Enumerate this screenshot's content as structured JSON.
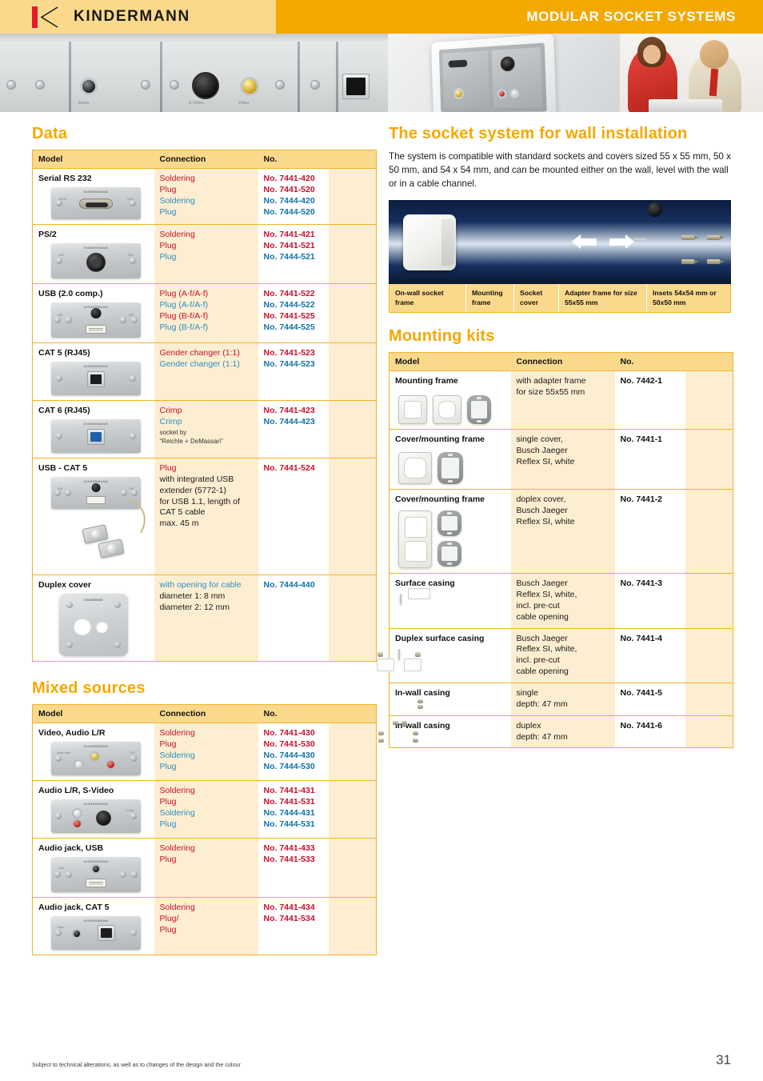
{
  "header": {
    "brand": "KINDERMANN",
    "title": "MODULAR SOCKET SYSTEMS",
    "logo_icon": "kindermann-chevron-logo"
  },
  "data_section": {
    "heading": "Data",
    "columns": [
      "Model",
      "Connection",
      "No."
    ],
    "rows": [
      {
        "model": "Serial RS 232",
        "image": "serial-rs232-faceplate",
        "connections": [
          {
            "text": "Soldering",
            "color": "red"
          },
          {
            "text": "Plug",
            "color": "red"
          },
          {
            "text": "Soldering",
            "color": "blue"
          },
          {
            "text": "Plug",
            "color": "blue"
          }
        ],
        "numbers": [
          {
            "text": "No. 7441-420",
            "color": "red"
          },
          {
            "text": "No. 7441-520",
            "color": "red"
          },
          {
            "text": "No. 7444-420",
            "color": "blue"
          },
          {
            "text": "No. 7444-520",
            "color": "blue"
          }
        ]
      },
      {
        "model": "PS/2",
        "image": "ps2-faceplate",
        "connections": [
          {
            "text": "Soldering",
            "color": "red"
          },
          {
            "text": "Plug",
            "color": "red"
          },
          {
            "text": "Plug",
            "color": "blue"
          }
        ],
        "numbers": [
          {
            "text": "No. 7441-421",
            "color": "red"
          },
          {
            "text": "No. 7441-521",
            "color": "red"
          },
          {
            "text": "No. 7444-521",
            "color": "blue"
          }
        ]
      },
      {
        "model": "USB (2.0 comp.)",
        "image": "usb-faceplate",
        "connections": [
          {
            "text": "Plug (A-f/A-f)",
            "color": "red"
          },
          {
            "text": "Plug (A-f/A-f)",
            "color": "blue"
          },
          {
            "text": "Plug (B-f/A-f)",
            "color": "red"
          },
          {
            "text": "Plug (B-f/A-f)",
            "color": "blue"
          }
        ],
        "numbers": [
          {
            "text": "No. 7441-522",
            "color": "red"
          },
          {
            "text": "No. 7444-522",
            "color": "blue"
          },
          {
            "text": "No. 7441-525",
            "color": "red"
          },
          {
            "text": "No. 7444-525",
            "color": "blue"
          }
        ]
      },
      {
        "model": "CAT 5 (RJ45)",
        "image": "cat5-rj45-faceplate",
        "connections": [
          {
            "text": "Gender changer (1:1)",
            "color": "red"
          },
          {
            "text": "Gender changer (1:1)",
            "color": "blue"
          }
        ],
        "numbers": [
          {
            "text": "No. 7441-523",
            "color": "red"
          },
          {
            "text": "No. 7444-523",
            "color": "blue"
          }
        ]
      },
      {
        "model": "CAT 6 (RJ45)",
        "image": "cat6-rj45-faceplate",
        "connections": [
          {
            "text": "Crimp",
            "color": "red"
          },
          {
            "text": "Crimp",
            "color": "blue"
          }
        ],
        "note_lines": [
          "socket by",
          "“Reichle + DeMassari”"
        ],
        "numbers": [
          {
            "text": "No. 7441-423",
            "color": "red"
          },
          {
            "text": "No. 7444-423",
            "color": "blue"
          }
        ]
      },
      {
        "model": "USB - CAT 5",
        "image": "usb-cat5-extender-faceplate",
        "connections": [
          {
            "text": "Plug",
            "color": "red"
          },
          {
            "text": "with integrated USB",
            "color": "dark"
          },
          {
            "text": "extender (5772-1)",
            "color": "dark"
          },
          {
            "text": "for USB 1.1, length of",
            "color": "dark"
          },
          {
            "text": "CAT 5 cable",
            "color": "dark"
          },
          {
            "text": "max. 45 m",
            "color": "dark"
          }
        ],
        "numbers": [
          {
            "text": "No. 7441-524",
            "color": "red"
          }
        ]
      },
      {
        "model": "Duplex cover",
        "image": "duplex-cover-plate",
        "connections": [
          {
            "text": "with opening for cable",
            "color": "blue"
          },
          {
            "text": "diameter 1:  8 mm",
            "color": "dark"
          },
          {
            "text": "diameter 2: 12 mm",
            "color": "dark"
          }
        ],
        "numbers": [
          {
            "text": "No. 7444-440",
            "color": "blue"
          }
        ]
      }
    ]
  },
  "mixed_section": {
    "heading": "Mixed sources",
    "columns": [
      "Model",
      "Connection",
      "No."
    ],
    "rows": [
      {
        "model": "Video, Audio L/R",
        "image": "video-audio-lr-faceplate",
        "connections": [
          {
            "text": "Soldering",
            "color": "red"
          },
          {
            "text": "Plug",
            "color": "red"
          },
          {
            "text": "Soldering",
            "color": "blue"
          },
          {
            "text": "Plug",
            "color": "blue"
          }
        ],
        "numbers": [
          {
            "text": "No. 7441-430",
            "color": "red"
          },
          {
            "text": "No. 7441-530",
            "color": "red"
          },
          {
            "text": "No. 7444-430",
            "color": "blue"
          },
          {
            "text": "No. 7444-530",
            "color": "blue"
          }
        ]
      },
      {
        "model": "Audio L/R, S-Video",
        "image": "audio-lr-svideo-faceplate",
        "connections": [
          {
            "text": "Soldering",
            "color": "red"
          },
          {
            "text": "Plug",
            "color": "red"
          },
          {
            "text": "Soldering",
            "color": "blue"
          },
          {
            "text": "Plug",
            "color": "blue"
          }
        ],
        "numbers": [
          {
            "text": "No. 7441-431",
            "color": "red"
          },
          {
            "text": "No. 7441-531",
            "color": "red"
          },
          {
            "text": "No. 7444-431",
            "color": "blue"
          },
          {
            "text": "No. 7444-531",
            "color": "blue"
          }
        ]
      },
      {
        "model": "Audio jack, USB",
        "image": "audio-jack-usb-faceplate",
        "connections": [
          {
            "text": "Soldering",
            "color": "red"
          },
          {
            "text": "Plug",
            "color": "red"
          }
        ],
        "numbers": [
          {
            "text": "No. 7441-433",
            "color": "red"
          },
          {
            "text": "No. 7441-533",
            "color": "red"
          }
        ]
      },
      {
        "model": "Audio jack, CAT 5",
        "image": "audio-jack-cat5-faceplate",
        "connections": [
          {
            "text": "Soldering",
            "color": "red"
          },
          {
            "text": "Plug/",
            "color": "red"
          },
          {
            "text": "Plug",
            "color": "red"
          }
        ],
        "numbers": [
          {
            "text": "No. 7441-434",
            "color": "red"
          },
          {
            "text": "No. 7441-534",
            "color": "red"
          }
        ]
      }
    ]
  },
  "wall_section": {
    "heading": "The socket system for wall installation",
    "intro": "The system is compatible with standard sockets and covers sized 55 x 55 mm, 50 x 50 mm, and 54 x 54 mm, and can be mounted either on the wall, level with the wall or in a cable channel.",
    "diagram_image": "exploded-socket-assembly",
    "captions": [
      "On-wall socket frame",
      "Mounting frame",
      "Socket cover",
      "Adapter frame for size 55x55 mm",
      "Insets 54x54 mm or 50x50 mm"
    ]
  },
  "mounting_section": {
    "heading": "Mounting kits",
    "columns": [
      "Model",
      "Connection",
      "No."
    ],
    "rows": [
      {
        "model": "Mounting frame",
        "image": "mounting-frame-set",
        "connections": [
          {
            "text": "with adapter frame",
            "color": "dark"
          },
          {
            "text": "for size 55x55 mm",
            "color": "dark"
          }
        ],
        "numbers": [
          {
            "text": "No. 7442-1",
            "color": "dark"
          }
        ]
      },
      {
        "model": "Cover/mounting frame",
        "image": "single-cover-mounting-frame",
        "connections": [
          {
            "text": "single cover,",
            "color": "dark"
          },
          {
            "text": "Busch Jaeger",
            "color": "dark"
          },
          {
            "text": "Reflex SI, white",
            "color": "dark"
          }
        ],
        "numbers": [
          {
            "text": "No. 7441-1",
            "color": "dark"
          }
        ]
      },
      {
        "model": "Cover/mounting frame",
        "image": "duplex-cover-mounting-frame",
        "connections": [
          {
            "text": "doplex cover,",
            "color": "dark"
          },
          {
            "text": "Busch Jaeger",
            "color": "dark"
          },
          {
            "text": "Reflex SI, white",
            "color": "dark"
          }
        ],
        "numbers": [
          {
            "text": "No. 7441-2",
            "color": "dark"
          }
        ]
      },
      {
        "model": "Surface casing",
        "image": "surface-casing",
        "connections": [
          {
            "text": "Busch Jaeger",
            "color": "dark"
          },
          {
            "text": "Reflex SI, white,",
            "color": "dark"
          },
          {
            "text": "incl. pre-cut",
            "color": "dark"
          },
          {
            "text": "cable opening",
            "color": "dark"
          }
        ],
        "numbers": [
          {
            "text": "No. 7441-3",
            "color": "dark"
          }
        ]
      },
      {
        "model": "Duplex surface casing",
        "image": "duplex-surface-casing",
        "connections": [
          {
            "text": "Busch Jaeger",
            "color": "dark"
          },
          {
            "text": "Reflex SI, white,",
            "color": "dark"
          },
          {
            "text": "incl. pre-cut",
            "color": "dark"
          },
          {
            "text": "cable opening",
            "color": "dark"
          }
        ],
        "numbers": [
          {
            "text": "No. 7441-4",
            "color": "dark"
          }
        ]
      },
      {
        "model": "In-wall casing",
        "image": "in-wall-casing-single-red",
        "connections": [
          {
            "text": "single",
            "color": "dark"
          },
          {
            "text": "depth: 47 mm",
            "color": "dark"
          }
        ],
        "numbers": [
          {
            "text": "No. 7441-5",
            "color": "dark"
          }
        ]
      },
      {
        "model": "In-wall casing",
        "image": "in-wall-casing-duplex-orange",
        "connections": [
          {
            "text": "duplex",
            "color": "dark"
          },
          {
            "text": "depth: 47 mm",
            "color": "dark"
          }
        ],
        "numbers": [
          {
            "text": "No. 7441-6",
            "color": "dark"
          }
        ]
      }
    ]
  },
  "footer": {
    "note": "Subject to technical alterations, as well as to changes of the design and the colour",
    "page_number": "31"
  }
}
